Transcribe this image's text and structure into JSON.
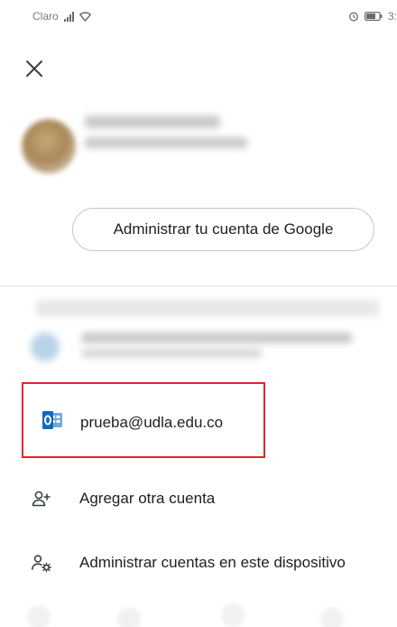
{
  "status_bar": {
    "carrier": "Claro",
    "time": "3:"
  },
  "icons": {
    "close": "close-icon",
    "outlook": "outlook-icon",
    "add_account": "add-person-icon",
    "manage_accounts": "manage-accounts-icon"
  },
  "account_menu": {
    "manage_button_label": "Administrar tu cuenta de Google",
    "selected_account_email": "prueba@udla.edu.co",
    "add_account_label": "Agregar otra cuenta",
    "manage_device_accounts_label": "Administrar cuentas en este dispositivo"
  },
  "colors": {
    "highlight_border": "#e52330",
    "outlook_blue": "#0f6cbd"
  }
}
